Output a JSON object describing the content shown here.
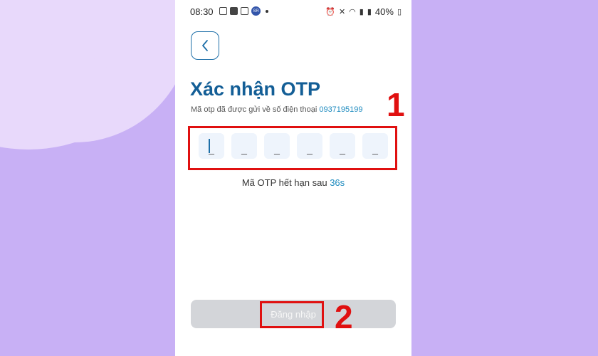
{
  "statusbar": {
    "time": "08:30",
    "avatar_text": "SR",
    "battery": "40%"
  },
  "screen": {
    "title": "Xác nhận OTP",
    "subtitle_text": "Mã otp đã được gửi về số điện thoại",
    "phone_number": "0937195199",
    "otp_placeholders": [
      "_",
      "_",
      "_",
      "_",
      "_",
      "_"
    ],
    "expiry_text": "Mã OTP hết hạn sau",
    "expiry_seconds": "36s",
    "login_label": "Đăng nhập"
  },
  "annotations": {
    "step1": "1",
    "step2": "2",
    "color": "#e01010"
  },
  "colors": {
    "background": "#c8b0f5",
    "title": "#135e96",
    "accent": "#1e8bbf",
    "button_disabled": "#d3d5d9"
  }
}
